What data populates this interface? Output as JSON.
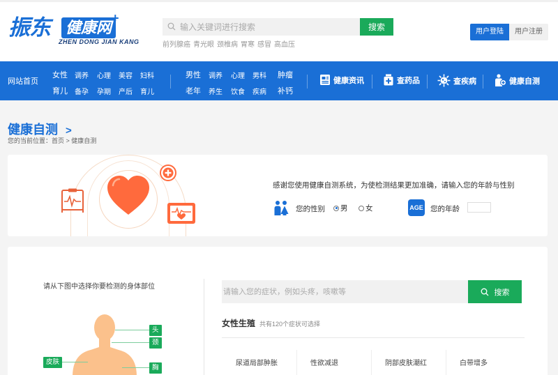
{
  "header": {
    "logo_main": "振东",
    "logo_box": "健康网",
    "logo_plus": "+",
    "logo_sub": "ZHEN DONG JIAN KANG",
    "search_placeholder": "输入关键词进行搜索",
    "search_button": "搜索",
    "hot_words": [
      "前列腺癌",
      "青光眼",
      "颈椎病",
      "胃寒",
      "感冒",
      "高血压"
    ],
    "login": "用户登陆",
    "register": "用户注册"
  },
  "nav": {
    "home": "网站首页",
    "group1": {
      "row1": [
        "女性",
        "调养",
        "心理",
        "美容",
        "妇科"
      ],
      "row2": [
        "育儿",
        "备孕",
        "孕期",
        "产后",
        "育儿"
      ]
    },
    "group2": {
      "row1": [
        "男性",
        "调养",
        "心理",
        "男科",
        "肿瘤"
      ],
      "row2": [
        "老年",
        "养生",
        "饮食",
        "疾病",
        "补钙"
      ]
    },
    "features": [
      {
        "label": "健康资讯",
        "icon": "news-icon"
      },
      {
        "label": "查药品",
        "icon": "medicine-icon"
      },
      {
        "label": "查疾病",
        "icon": "virus-icon"
      },
      {
        "label": "健康自测",
        "icon": "self-test-icon"
      }
    ]
  },
  "page": {
    "title": "健康自测",
    "title_arrow": ">",
    "crumb": "您的当前位置：首页 > 健康自测"
  },
  "intro": {
    "text": "感谢您使用健康自测系统，为使检测结果更加准确，请输入您的年龄与性别",
    "gender_label": "您的性别",
    "male": "男",
    "female": "女",
    "selected_gender": "男",
    "age_badge": "AGE",
    "age_label": "您的年龄",
    "age_value": ""
  },
  "body_select": {
    "hint": "请从下图中选择你要检测的身体部位",
    "tags": [
      "头",
      "颈",
      "皮肤",
      "胸"
    ]
  },
  "symptoms": {
    "placeholder": "请输入您的症状，例如头疼，咳嗽等",
    "button": "搜索",
    "section_title": "女性生殖",
    "section_sub": "共有120个症状可选择",
    "items": [
      "尿道局部肿胀",
      "性欲减退",
      "阴部皮肤潮红",
      "白带增多"
    ]
  },
  "colors": {
    "primary": "#1a6fd6",
    "green": "#1aaa5a",
    "heart": "#ff6a3d"
  }
}
